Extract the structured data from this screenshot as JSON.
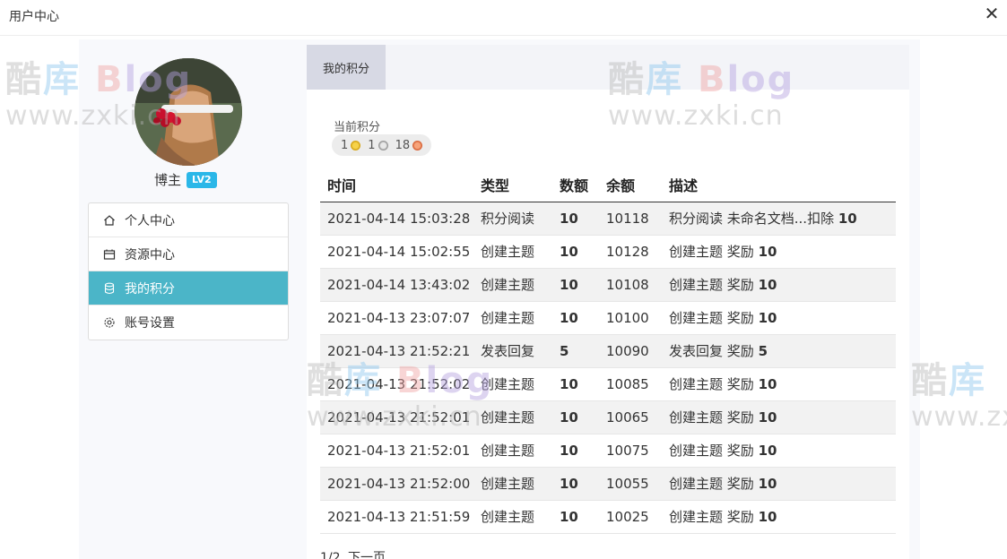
{
  "window": {
    "title": "用户中心"
  },
  "user": {
    "name": "博主",
    "level": "LV2"
  },
  "menu": {
    "items": [
      {
        "label": "个人中心",
        "icon": "home-icon"
      },
      {
        "label": "资源中心",
        "icon": "folder-icon"
      },
      {
        "label": "我的积分",
        "icon": "database-icon",
        "active": true
      },
      {
        "label": "账号设置",
        "icon": "gear-icon"
      }
    ]
  },
  "tab": {
    "label": "我的积分"
  },
  "points": {
    "label": "当前积分",
    "gold": "1",
    "silver": "1",
    "bronze": "18"
  },
  "table": {
    "headers": [
      "时间",
      "类型",
      "数额",
      "余额",
      "描述"
    ],
    "rows": [
      {
        "time": "2021-04-14 15:03:28",
        "type": "积分阅读",
        "amount": "10",
        "balance": "10118",
        "desc": "积分阅读 未命名文档...扣除",
        "desc_value": "10"
      },
      {
        "time": "2021-04-14 15:02:55",
        "type": "创建主题",
        "amount": "10",
        "balance": "10128",
        "desc": "创建主题 奖励",
        "desc_value": "10"
      },
      {
        "time": "2021-04-14 13:43:02",
        "type": "创建主题",
        "amount": "10",
        "balance": "10108",
        "desc": "创建主题 奖励",
        "desc_value": "10"
      },
      {
        "time": "2021-04-13 23:07:07",
        "type": "创建主题",
        "amount": "10",
        "balance": "10100",
        "desc": "创建主题 奖励",
        "desc_value": "10"
      },
      {
        "time": "2021-04-13 21:52:21",
        "type": "发表回复",
        "amount": "5",
        "balance": "10090",
        "desc": "发表回复 奖励",
        "desc_value": "5"
      },
      {
        "time": "2021-04-13 21:52:02",
        "type": "创建主题",
        "amount": "10",
        "balance": "10085",
        "desc": "创建主题 奖励",
        "desc_value": "10"
      },
      {
        "time": "2021-04-13 21:52:01",
        "type": "创建主题",
        "amount": "10",
        "balance": "10065",
        "desc": "创建主题 奖励",
        "desc_value": "10"
      },
      {
        "time": "2021-04-13 21:52:01",
        "type": "创建主题",
        "amount": "10",
        "balance": "10075",
        "desc": "创建主题 奖励",
        "desc_value": "10"
      },
      {
        "time": "2021-04-13 21:52:00",
        "type": "创建主题",
        "amount": "10",
        "balance": "10055",
        "desc": "创建主题 奖励",
        "desc_value": "10"
      },
      {
        "time": "2021-04-13 21:51:59",
        "type": "创建主题",
        "amount": "10",
        "balance": "10025",
        "desc": "创建主题 奖励",
        "desc_value": "10"
      }
    ]
  },
  "pager": {
    "page": "1/2",
    "next": "下一页"
  },
  "watermark": {
    "line1_a": "酷",
    "line1_b": "库",
    "line1_c": "B",
    "line1_d": "log",
    "line2": "www.zxki.cn"
  }
}
